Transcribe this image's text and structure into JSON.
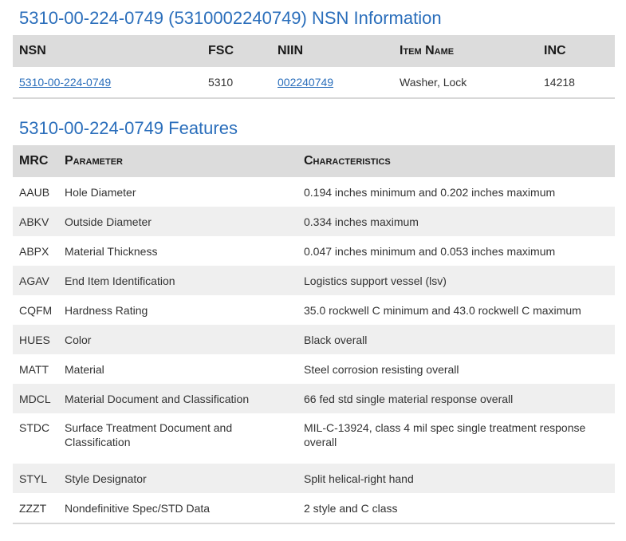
{
  "nsn_section": {
    "title": "5310-00-224-0749 (5310002240749) NSN Information",
    "headers": [
      "NSN",
      "FSC",
      "NIIN",
      "Item Name",
      "INC"
    ],
    "row": {
      "nsn": "5310-00-224-0749",
      "fsc": "5310",
      "niin": "002240749",
      "item_name": "Washer, Lock",
      "inc": "14218"
    }
  },
  "features_section": {
    "title": "5310-00-224-0749 Features",
    "headers": [
      "MRC",
      "Parameter",
      "Characteristics"
    ],
    "rows": [
      {
        "mrc": "AAUB",
        "parameter": "Hole Diameter",
        "characteristics": "0.194 inches minimum and 0.202 inches maximum"
      },
      {
        "mrc": "ABKV",
        "parameter": "Outside Diameter",
        "characteristics": "0.334 inches maximum"
      },
      {
        "mrc": "ABPX",
        "parameter": "Material Thickness",
        "characteristics": "0.047 inches minimum and 0.053 inches maximum"
      },
      {
        "mrc": "AGAV",
        "parameter": "End Item Identification",
        "characteristics": "Logistics support vessel (lsv)"
      },
      {
        "mrc": "CQFM",
        "parameter": "Hardness Rating",
        "characteristics": "35.0 rockwell C minimum and 43.0 rockwell C maximum"
      },
      {
        "mrc": "HUES",
        "parameter": "Color",
        "characteristics": "Black overall"
      },
      {
        "mrc": "MATT",
        "parameter": "Material",
        "characteristics": "Steel corrosion resisting overall"
      },
      {
        "mrc": "MDCL",
        "parameter": "Material Document and Classification",
        "characteristics": "66 fed std single material response overall"
      },
      {
        "mrc": "STDC",
        "parameter": "Surface Treatment Document and Classification",
        "characteristics": "MIL-C-13924, class 4 mil spec single treatment response overall"
      },
      {
        "mrc": "STYL",
        "parameter": "Style Designator",
        "characteristics": "Split helical-right hand"
      },
      {
        "mrc": "ZZZT",
        "parameter": "Nondefinitive Spec/STD Data",
        "characteristics": "2 style and C class"
      }
    ]
  },
  "colors": {
    "title": "#2a6ebb",
    "link": "#2a6ebb",
    "header_bg": "#dcdcdc",
    "stripe_bg": "#efefef"
  }
}
